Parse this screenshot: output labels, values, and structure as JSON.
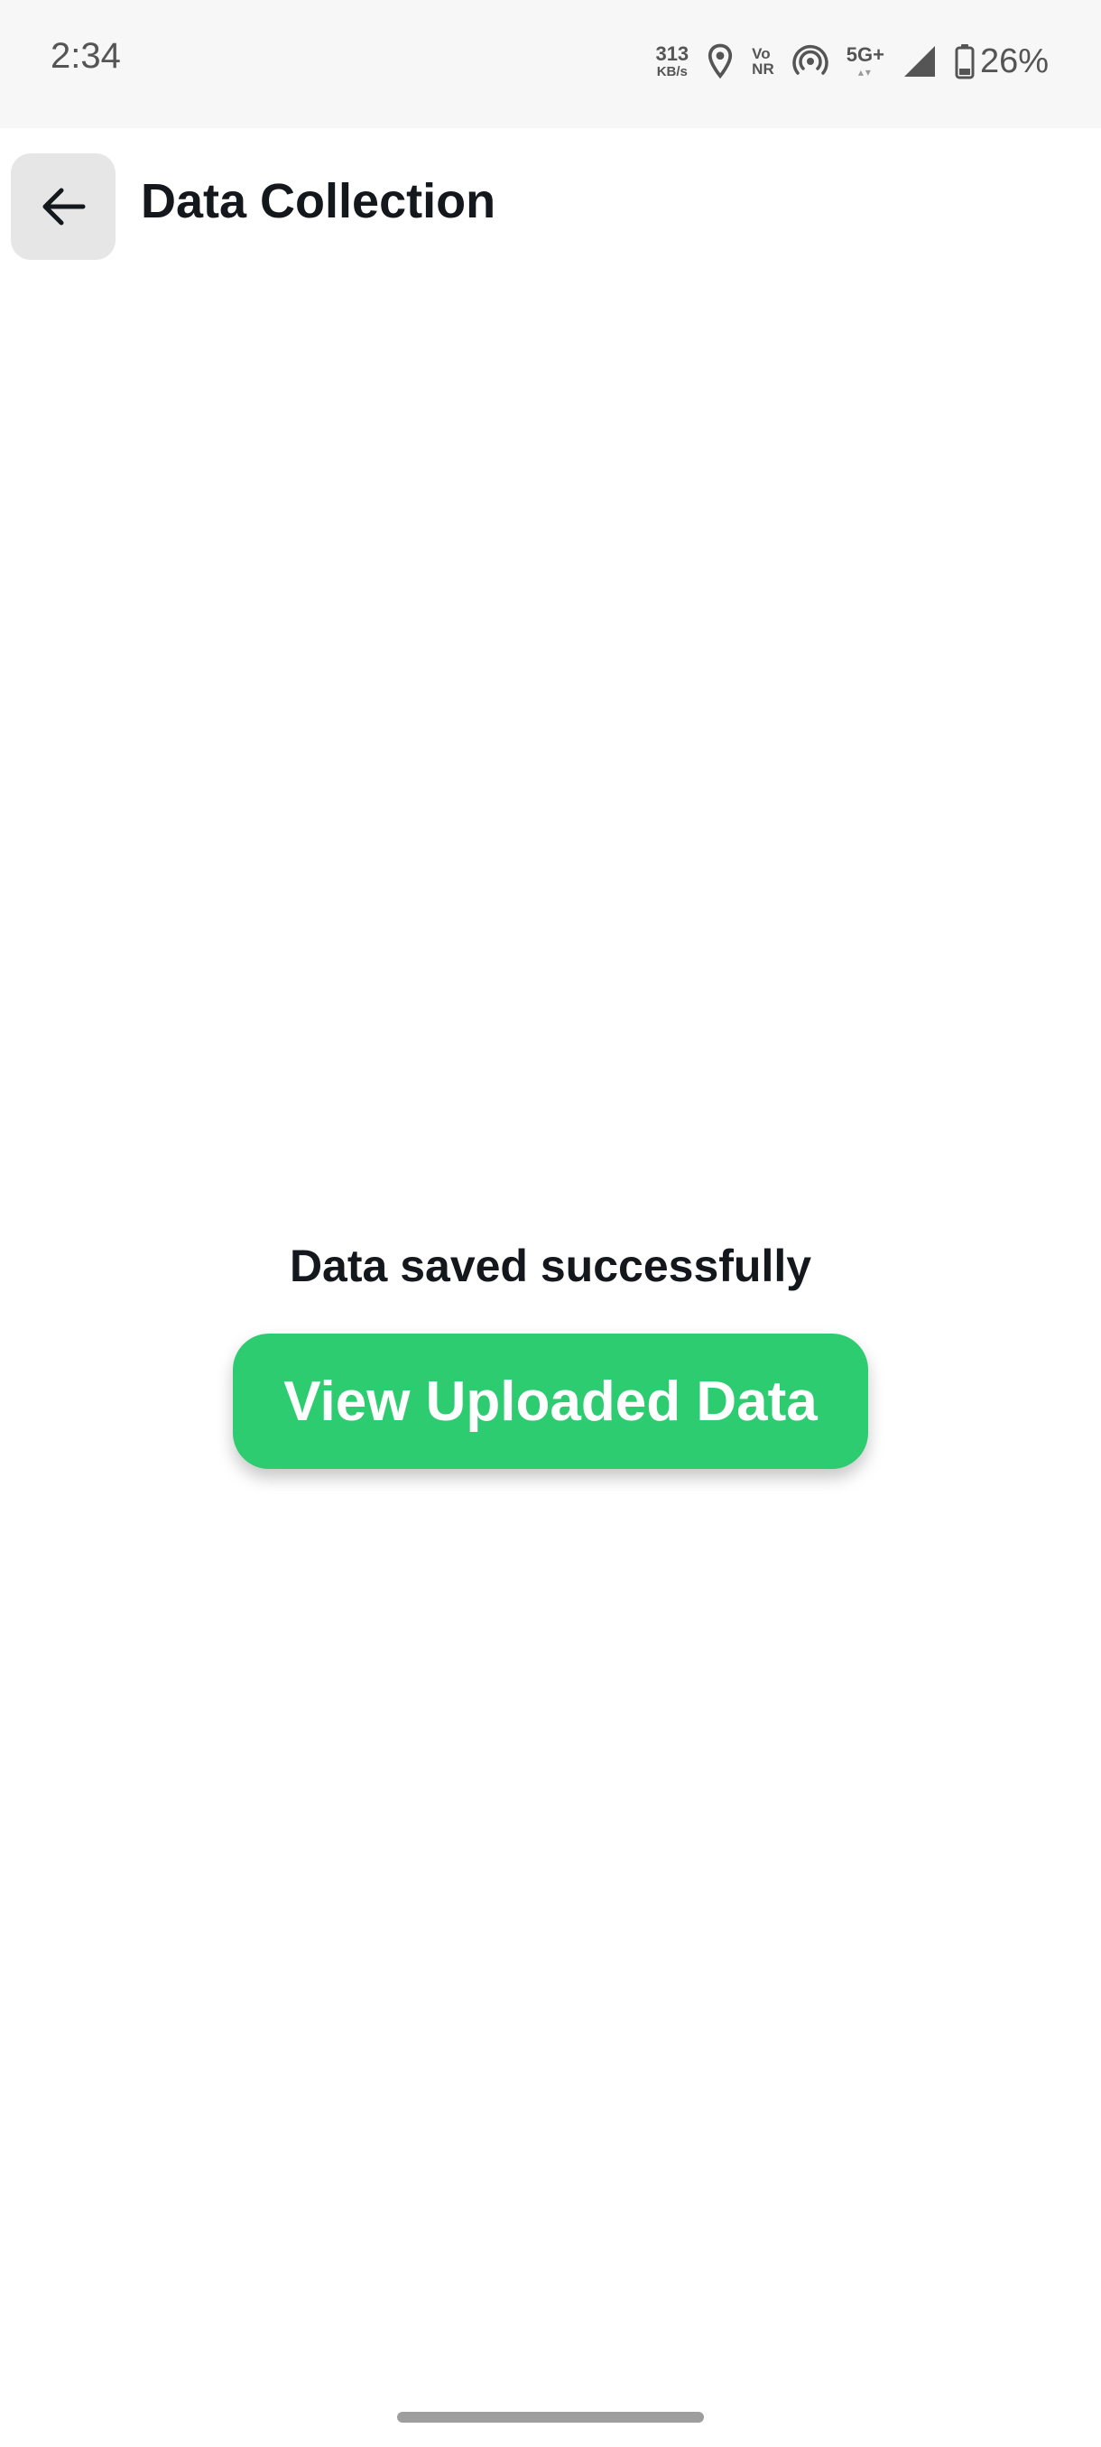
{
  "status_bar": {
    "time": "2:34",
    "net_speed_value": "313",
    "net_speed_unit": "KB/s",
    "vonr_top": "Vo",
    "vonr_bottom": "NR",
    "network_type": "5G+",
    "battery_percent": "26%",
    "icons": [
      "location-icon",
      "vonr-icon",
      "hotspot-icon",
      "signal-icon",
      "battery-icon"
    ]
  },
  "header": {
    "back_icon": "arrow-left-icon",
    "title": "Data Collection"
  },
  "main": {
    "message": "Data saved successfully",
    "button_label": "View Uploaded Data"
  },
  "colors": {
    "accent": "#2ecc71",
    "text": "#14181c",
    "back_button_bg": "#e6e6e6",
    "status_bar_bg": "#f7f7f7"
  }
}
